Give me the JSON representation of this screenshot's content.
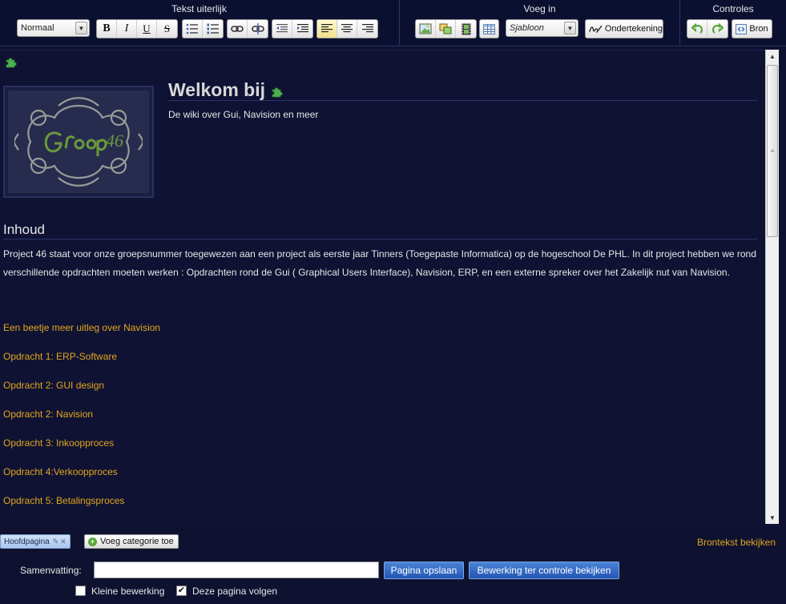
{
  "toolbar": {
    "group_text": "Tekst uiterlijk",
    "group_insert": "Voeg in",
    "group_controls": "Controles",
    "format_select": "Normaal",
    "template_select": "Sjabloon",
    "signature_label": "Ondertekening",
    "source_label": "Bron",
    "bold": "B",
    "italic": "I",
    "underline": "U",
    "strike": "S"
  },
  "content": {
    "heading": "Welkom bij",
    "subtitle": "De wiki over Gui, Navision en meer",
    "logo_text": "Groep 46",
    "section_title": "Inhoud",
    "paragraph": "Project 46 staat voor onze groepsnummer toegewezen aan een project als eerste jaar Tinners (Toegepaste Informatica) op de hogeschool De PHL. In dit project hebben we rond verschillende opdrachten moeten werken : Opdrachten rond de Gui ( Graphical Users Interface), Navision, ERP, en een externe spreker over het Zakelijk nut van Navision.",
    "links": [
      "Een beetje meer uitleg over Navision",
      "Opdracht 1: ERP-Software",
      "Opdracht 2: GUI design",
      "Opdracht 2: Navision",
      "Opdracht 3: Inkoopproces",
      "Opdracht 4:Verkoopproces",
      "Opdracht 5: Betalingsproces"
    ]
  },
  "categories": {
    "tag": "Hoofdpagina",
    "add_label": "Voeg categorie toe",
    "source_link": "Brontekst bekijken"
  },
  "form": {
    "summary_label": "Samenvatting:",
    "summary_value": "",
    "save_button": "Pagina opslaan",
    "preview_button": "Bewerking ter controle bekijken",
    "minor_label": "Kleine bewerking",
    "minor_checked": "",
    "watch_label": "Deze pagina volgen",
    "watch_checked": "✔"
  },
  "colors": {
    "background": "#0e1230",
    "link": "#e2a61d",
    "button_blue": "#2f65c2",
    "puzzle_green": "#4caf50"
  }
}
